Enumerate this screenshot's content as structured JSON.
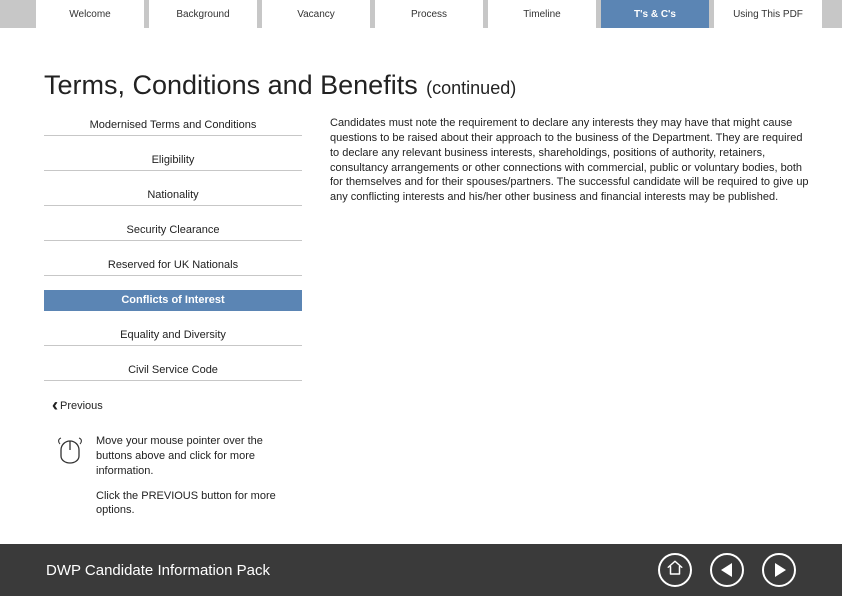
{
  "tabs": [
    {
      "label": "Welcome"
    },
    {
      "label": "Background"
    },
    {
      "label": "Vacancy"
    },
    {
      "label": "Process"
    },
    {
      "label": "Timeline"
    },
    {
      "label": "T's & C's"
    },
    {
      "label": "Using This PDF"
    }
  ],
  "title": "Terms, Conditions and Benefits",
  "title_suffix": "(continued)",
  "sidebar": [
    {
      "label": "Modernised Terms and Conditions"
    },
    {
      "label": "Eligibility"
    },
    {
      "label": "Nationality"
    },
    {
      "label": "Security Clearance"
    },
    {
      "label": "Reserved for UK Nationals"
    },
    {
      "label": "Conflicts of Interest"
    },
    {
      "label": "Equality and Diversity"
    },
    {
      "label": "Civil Service Code"
    }
  ],
  "body_text": "Candidates must note the requirement to declare any interests they may have that might cause questions to be raised about their approach to the business of the Department. They are required to declare any relevant business interests, shareholdings, positions of authority, retainers, consultancy arrangements or other connections with commercial, public or voluntary bodies, both for themselves and for their spouses/partners. The successful candidate will be required to give up any conflicting interests and his/her other business and financial interests may be published.",
  "prev_label": "Previous",
  "hint1": "Move your mouse pointer over the buttons above and click for more information.",
  "hint2": "Click the PREVIOUS button for more options.",
  "footer_title": "DWP Candidate Information Pack"
}
